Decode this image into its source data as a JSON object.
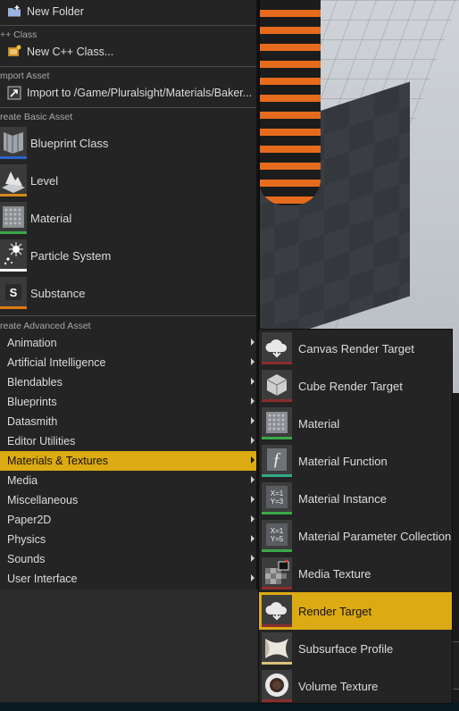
{
  "colors": {
    "highlight": "#dcaa12",
    "menu_bg": "#242424",
    "orange": "#e66b1d"
  },
  "menu": {
    "new_folder": "New Folder",
    "cpp_section": "++ Class",
    "new_cpp_class": "New C++ Class...",
    "import_section": "mport Asset",
    "import_to": "Import to /Game/Pluralsight/Materials/Baker...",
    "basic_section": "reate Basic Asset",
    "basic_items": [
      {
        "label": "Blueprint Class",
        "icon": "blueprint-icon",
        "color": "#2a62c9"
      },
      {
        "label": "Level",
        "icon": "level-icon",
        "color": "#d58a1c"
      },
      {
        "label": "Material",
        "icon": "material-icon",
        "color": "#3aa84a"
      },
      {
        "label": "Particle System",
        "icon": "particle-icon",
        "color": "#ffffff"
      },
      {
        "label": "Substance",
        "icon": "substance-icon",
        "color": "#e07a10"
      }
    ],
    "advanced_section": "reate Advanced Asset",
    "advanced_items": [
      "Animation",
      "Artificial Intelligence",
      "Blendables",
      "Blueprints",
      "Datasmith",
      "Editor Utilities",
      "Materials & Textures",
      "Media",
      "Miscellaneous",
      "Paper2D",
      "Physics",
      "Sounds",
      "User Interface"
    ],
    "active_advanced": "Materials & Textures"
  },
  "submenu": {
    "items": [
      {
        "label": "Canvas Render Target",
        "icon": "canvas-render-target-icon",
        "color": "#8a2e2e"
      },
      {
        "label": "Cube Render Target",
        "icon": "cube-render-target-icon",
        "color": "#8a2e2e"
      },
      {
        "label": "Material",
        "icon": "material-icon",
        "color": "#3aa84a"
      },
      {
        "label": "Material Function",
        "icon": "material-function-icon",
        "color": "#2faa86"
      },
      {
        "label": "Material Instance",
        "icon": "material-instance-icon",
        "color": "#3aa84a"
      },
      {
        "label": "Material Parameter Collection",
        "icon": "material-parameter-collection-icon",
        "color": "#3aa84a"
      },
      {
        "label": "Media Texture",
        "icon": "media-texture-icon",
        "color": "#8a2e2e"
      },
      {
        "label": "Render Target",
        "icon": "render-target-icon",
        "color": "#8a2e2e"
      },
      {
        "label": "Subsurface Profile",
        "icon": "subsurface-profile-icon",
        "color": "#d9c27a"
      },
      {
        "label": "Volume Texture",
        "icon": "volume-texture-icon",
        "color": "#8a2e2e"
      }
    ],
    "active": "Render Target",
    "glyphs": {
      "material_function": "ƒ",
      "material_instance": "X=1 Y=3",
      "material_parameter_collection": "X=1 Y=5"
    }
  }
}
